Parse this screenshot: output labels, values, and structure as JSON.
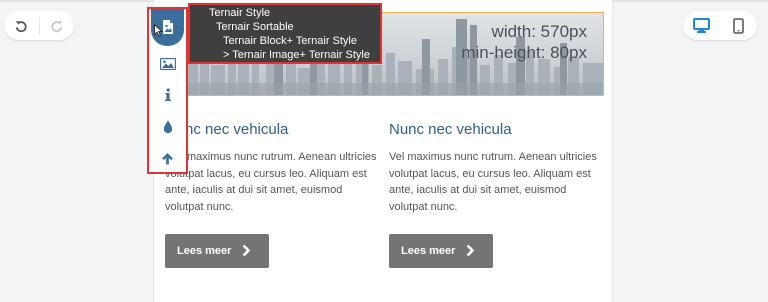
{
  "toolbar": {
    "undo_icon": "undo-icon",
    "redo_icon": "redo-icon"
  },
  "devices": {
    "desktop_icon": "desktop-icon",
    "mobile_icon": "mobile-icon",
    "active_color": "#1a8ad6"
  },
  "hero": {
    "width_label": "width: 570px",
    "min_height_label": "min-height: 80px",
    "outline_color": "#f3b14a"
  },
  "breadcrumb": {
    "items": [
      "Ternair Style",
      "Ternair Sortable",
      "Ternair Block+ Ternair Style",
      "> Ternair Image+ Ternair Style"
    ]
  },
  "tool_panel": {
    "tools": [
      "image-file-icon",
      "picture-icon",
      "info-icon",
      "droplet-icon",
      "arrow-up-icon"
    ],
    "active_index": 0,
    "highlight_color": "#e03333"
  },
  "columns": [
    {
      "title": "nc nec vehicula",
      "lines": [
        "maximus nunc rutrum. Aenean ultricies",
        "volutpat lacus, eu cursus leo. Aliquam est",
        "ante, iaculis at dui sit amet, euismod",
        "volutpat nunc."
      ],
      "button": "Lees meer"
    },
    {
      "title": "Nunc nec vehicula",
      "lines": [
        "Vel maximus nunc rutrum. Aenean ultricies",
        "volutpat lacus, eu cursus leo. Aliquam est",
        "ante, iaculis at dui sit amet, euismod",
        "volutpat nunc."
      ],
      "button": "Lees meer"
    }
  ]
}
